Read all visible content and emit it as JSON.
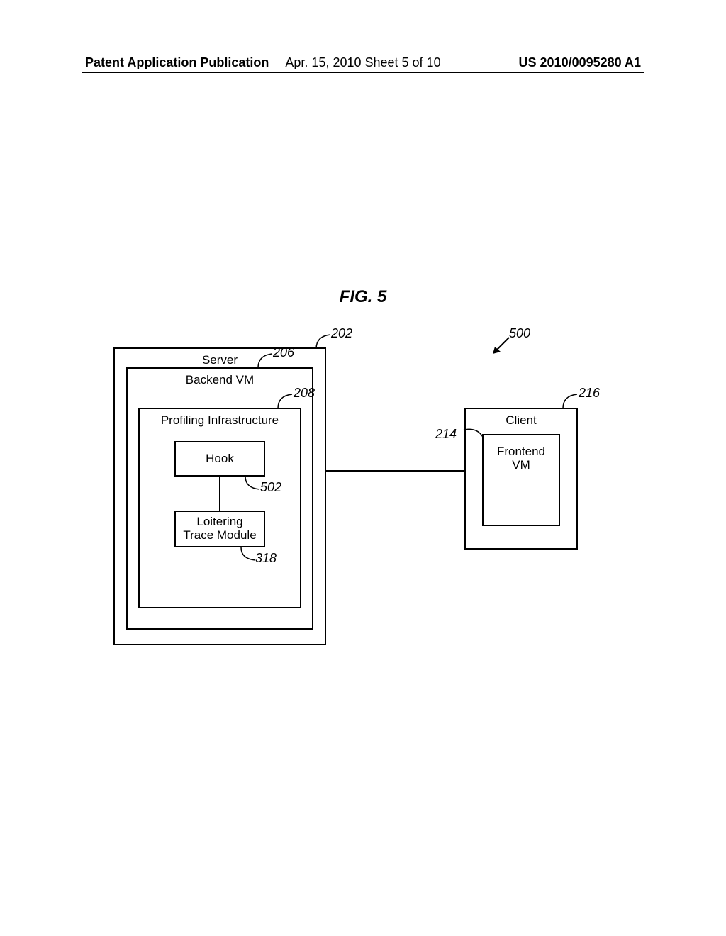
{
  "header": {
    "left": "Patent Application Publication",
    "center": "Apr. 15, 2010  Sheet 5 of 10",
    "right": "US 2010/0095280 A1"
  },
  "figure": {
    "title": "FIG. 5"
  },
  "refs": {
    "r500": "500",
    "r202": "202",
    "r206": "206",
    "r208": "208",
    "r502": "502",
    "r318": "318",
    "r216": "216",
    "r214": "214"
  },
  "boxes": {
    "server": "Server",
    "backend_vm": "Backend VM",
    "profiling": "Profiling Infrastructure",
    "hook": "Hook",
    "loitering": "Loitering\nTrace Module",
    "client": "Client",
    "frontend_vm": "Frontend\nVM"
  }
}
